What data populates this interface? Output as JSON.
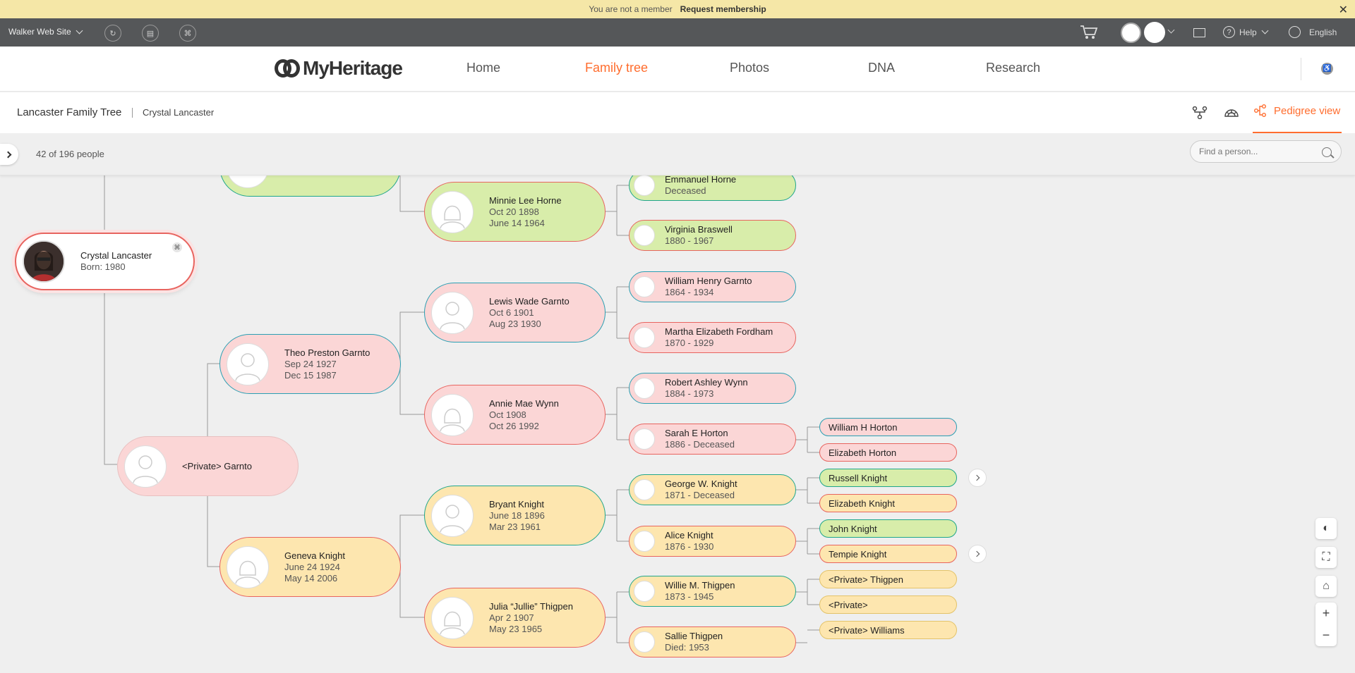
{
  "banner": {
    "text": "You are not a member",
    "action": "Request membership"
  },
  "topbar": {
    "site_name": "Walker Web Site",
    "help_label": "Help",
    "language": "English"
  },
  "nav": {
    "logo_text": "MyHeritage",
    "items": [
      {
        "label": "Home"
      },
      {
        "label": "Family tree"
      },
      {
        "label": "Photos"
      },
      {
        "label": "DNA"
      },
      {
        "label": "Research"
      }
    ],
    "active": "Family tree"
  },
  "breadcrumb": {
    "tree_name": "Lancaster Family Tree",
    "person": "Crystal Lancaster",
    "view_label": "Pedigree view"
  },
  "toolbar": {
    "count_text": "42 of 196 people",
    "search_placeholder": "Find a person..."
  },
  "colors": {
    "accent": "#ff6d2e",
    "green_card": "#d8edaa",
    "pink_card": "#fbd6d6",
    "yellow_card": "#fde6af",
    "female_border": "#e8645f",
    "male_border": "#2a9fb3"
  },
  "tree": {
    "root": {
      "name": "Crystal Lancaster",
      "d1": "Born: 1980"
    },
    "parents": {
      "top_partial": {
        "name": ""
      },
      "father": {
        "name": "<Private> Garnto"
      }
    },
    "grandparents": {
      "theo": {
        "name": "Theo Preston Garnto",
        "d1": "Sep 24 1927",
        "d2": "Dec 15 1987"
      },
      "geneva": {
        "name": "Geneva Knight",
        "d1": "June 24 1924",
        "d2": "May 14 2006"
      }
    },
    "gen3": {
      "minnie": {
        "name": "Minnie Lee Horne",
        "d1": "Oct 20 1898",
        "d2": "June 14 1964"
      },
      "lewis": {
        "name": "Lewis Wade Garnto",
        "d1": "Oct 6 1901",
        "d2": "Aug 23 1930"
      },
      "annie": {
        "name": "Annie Mae Wynn",
        "d1": "Oct 1908",
        "d2": "Oct 26 1992"
      },
      "bryant": {
        "name": "Bryant Knight",
        "d1": "June 18 1896",
        "d2": "Mar 23 1961"
      },
      "julia": {
        "name": "Julia “Jullie” Thigpen",
        "d1": "Apr 2 1907",
        "d2": "May 23 1965"
      }
    },
    "gen4": {
      "emmanuel": {
        "name": "Emmanuel Horne",
        "d1": "Deceased"
      },
      "virginia": {
        "name": "Virginia Braswell",
        "d1": "1880 - 1967"
      },
      "william": {
        "name": "William Henry Garnto",
        "d1": "1864 - 1934"
      },
      "martha": {
        "name": "Martha Elizabeth Fordham",
        "d1": "1870 - 1929"
      },
      "robert": {
        "name": "Robert Ashley Wynn",
        "d1": "1884 - 1973"
      },
      "sarah": {
        "name": "Sarah E Horton",
        "d1": "1886 - Deceased"
      },
      "george": {
        "name": "George W. Knight",
        "d1": "1871 - Deceased"
      },
      "alice": {
        "name": "Alice Knight",
        "d1": "1876 - 1930"
      },
      "willie": {
        "name": "Willie M. Thigpen",
        "d1": "1873 - 1945"
      },
      "sallie": {
        "name": "Sallie Thigpen",
        "d1": "Died: 1953"
      }
    },
    "gen5": {
      "william_h": {
        "name": "William H Horton"
      },
      "elizabeth_h": {
        "name": "Elizabeth Horton"
      },
      "russell": {
        "name": "Russell Knight"
      },
      "elizabeth_k": {
        "name": "Elizabeth Knight"
      },
      "john": {
        "name": "John Knight"
      },
      "tempie": {
        "name": "Tempie Knight"
      },
      "p_thigpen": {
        "name": "<Private> Thigpen"
      },
      "p_private": {
        "name": "<Private>"
      },
      "p_williams": {
        "name": "<Private> Williams"
      }
    }
  }
}
